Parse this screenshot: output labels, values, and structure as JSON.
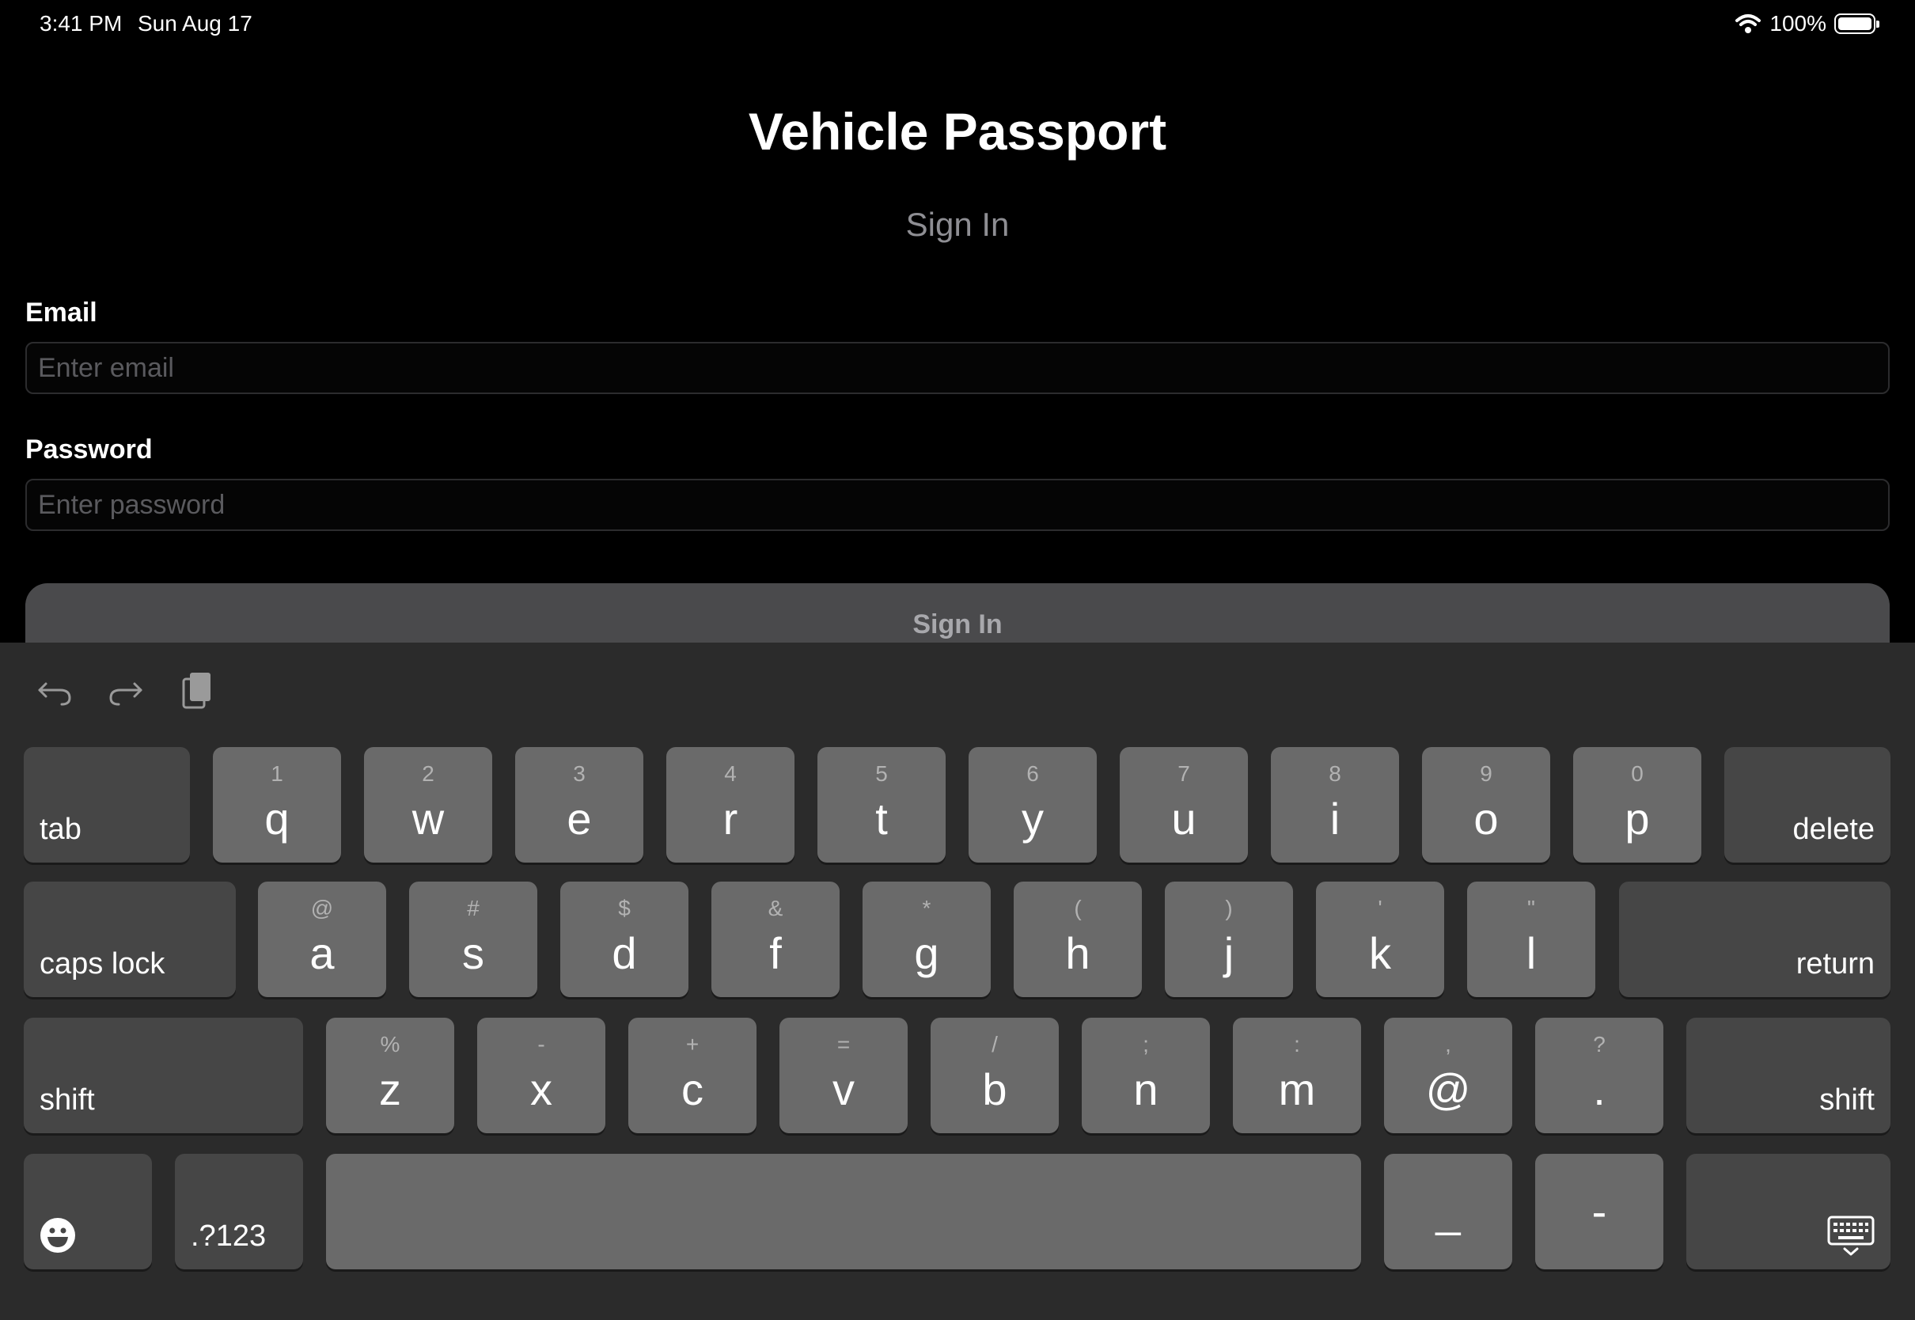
{
  "status_bar": {
    "time": "3:41 PM",
    "date": "Sun Aug 17",
    "battery": "100%"
  },
  "app": {
    "title": "Vehicle Passport",
    "subtitle": "Sign In"
  },
  "form": {
    "email_label": "Email",
    "email_placeholder": "Enter email",
    "password_label": "Password",
    "password_placeholder": "Enter password",
    "submit_label": "Sign In"
  },
  "keyboard": {
    "toolbar": [
      "undo-icon",
      "redo-icon",
      "clipboard-icon"
    ],
    "row1": [
      {
        "main": "q",
        "alt": "1"
      },
      {
        "main": "w",
        "alt": "2"
      },
      {
        "main": "e",
        "alt": "3"
      },
      {
        "main": "r",
        "alt": "4"
      },
      {
        "main": "t",
        "alt": "5"
      },
      {
        "main": "y",
        "alt": "6"
      },
      {
        "main": "u",
        "alt": "7"
      },
      {
        "main": "i",
        "alt": "8"
      },
      {
        "main": "o",
        "alt": "9"
      },
      {
        "main": "p",
        "alt": "0"
      }
    ],
    "row2": [
      {
        "main": "a",
        "alt": "@"
      },
      {
        "main": "s",
        "alt": "#"
      },
      {
        "main": "d",
        "alt": "$"
      },
      {
        "main": "f",
        "alt": "&"
      },
      {
        "main": "g",
        "alt": "*"
      },
      {
        "main": "h",
        "alt": "("
      },
      {
        "main": "j",
        "alt": ")"
      },
      {
        "main": "k",
        "alt": "'"
      },
      {
        "main": "l",
        "alt": "\""
      }
    ],
    "row3": [
      {
        "main": "z",
        "alt": "%"
      },
      {
        "main": "x",
        "alt": "-"
      },
      {
        "main": "c",
        "alt": "+"
      },
      {
        "main": "v",
        "alt": "="
      },
      {
        "main": "b",
        "alt": "/"
      },
      {
        "main": "n",
        "alt": ";"
      },
      {
        "main": "m",
        "alt": ":"
      },
      {
        "main": "@",
        "alt": ","
      },
      {
        "main": ".",
        "alt": "?"
      }
    ],
    "tab": "tab",
    "delete": "delete",
    "caps_lock": "caps lock",
    "return": "return",
    "shift": "shift",
    "numbers": ".?123",
    "underscore": "_",
    "dash": "-",
    "emoji_icon": "emoji-icon",
    "hide_keyboard_icon": "keyboard-dismiss-icon"
  }
}
